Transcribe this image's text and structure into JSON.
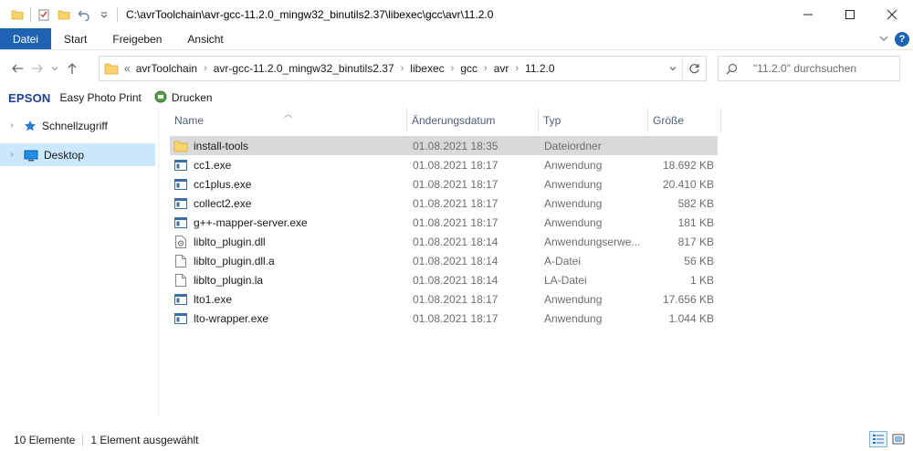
{
  "titlebar": {
    "path": "C:\\avrToolchain\\avr-gcc-11.2.0_mingw32_binutils2.37\\libexec\\gcc\\avr\\11.2.0",
    "minimize_icon": "minimize-icon",
    "maximize_icon": "maximize-icon",
    "close_icon": "close-icon"
  },
  "ribbon": {
    "tabs": [
      "Datei",
      "Start",
      "Freigeben",
      "Ansicht"
    ],
    "active_tab": "Datei",
    "accent": "#1f63b4"
  },
  "address": {
    "overflow": "«",
    "crumbs": [
      "avrToolchain",
      "avr-gcc-11.2.0_mingw32_binutils2.37",
      "libexec",
      "gcc",
      "avr",
      "11.2.0"
    ]
  },
  "search": {
    "placeholder": "\"11.2.0\" durchsuchen"
  },
  "epson": {
    "logo": "EPSON",
    "photo_print": "Easy Photo Print",
    "print": "Drucken"
  },
  "navpane": {
    "items": [
      {
        "label": "Schnellzugriff",
        "icon": "star-icon",
        "selected": false
      },
      {
        "label": "Desktop",
        "icon": "desktop-icon",
        "selected": true
      }
    ]
  },
  "columns": {
    "name": "Name",
    "date": "Änderungsdatum",
    "type": "Typ",
    "size": "Größe"
  },
  "files": [
    {
      "name": "install-tools",
      "date": "01.08.2021 18:35",
      "type": "Dateiordner",
      "size": "",
      "icon": "folder-icon",
      "selected": true
    },
    {
      "name": "cc1.exe",
      "date": "01.08.2021 18:17",
      "type": "Anwendung",
      "size": "18.692 KB",
      "icon": "exe-icon",
      "selected": false
    },
    {
      "name": "cc1plus.exe",
      "date": "01.08.2021 18:17",
      "type": "Anwendung",
      "size": "20.410 KB",
      "icon": "exe-icon",
      "selected": false
    },
    {
      "name": "collect2.exe",
      "date": "01.08.2021 18:17",
      "type": "Anwendung",
      "size": "582 KB",
      "icon": "exe-icon",
      "selected": false
    },
    {
      "name": "g++-mapper-server.exe",
      "date": "01.08.2021 18:17",
      "type": "Anwendung",
      "size": "181 KB",
      "icon": "exe-icon",
      "selected": false
    },
    {
      "name": "liblto_plugin.dll",
      "date": "01.08.2021 18:14",
      "type": "Anwendungserwe...",
      "size": "817 KB",
      "icon": "dll-icon",
      "selected": false
    },
    {
      "name": "liblto_plugin.dll.a",
      "date": "01.08.2021 18:14",
      "type": "A-Datei",
      "size": "56 KB",
      "icon": "file-icon",
      "selected": false
    },
    {
      "name": "liblto_plugin.la",
      "date": "01.08.2021 18:14",
      "type": "LA-Datei",
      "size": "1 KB",
      "icon": "file-icon",
      "selected": false
    },
    {
      "name": "lto1.exe",
      "date": "01.08.2021 18:17",
      "type": "Anwendung",
      "size": "17.656 KB",
      "icon": "exe-icon",
      "selected": false
    },
    {
      "name": "lto-wrapper.exe",
      "date": "01.08.2021 18:17",
      "type": "Anwendung",
      "size": "1.044 KB",
      "icon": "exe-icon",
      "selected": false
    }
  ],
  "status": {
    "count": "10 Elemente",
    "selection": "1 Element ausgewählt"
  }
}
